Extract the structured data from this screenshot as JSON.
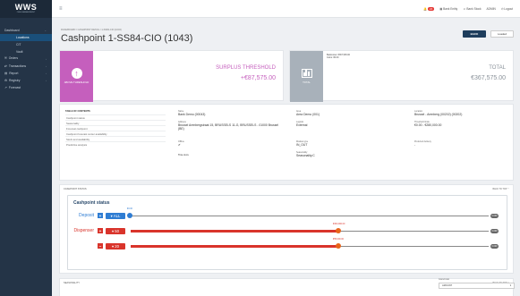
{
  "app": {
    "logo": "WWS",
    "logo_sub": "CASH MANAGEMENT"
  },
  "sidebar": {
    "items": [
      {
        "label": "Dashboard",
        "icon": "dashboard-icon"
      },
      {
        "label": "Locations",
        "active": true
      },
      {
        "label": "CIT"
      },
      {
        "label": "Vault"
      },
      {
        "label": "Orders",
        "icon": "orders-icon"
      },
      {
        "label": "Transactions",
        "icon": "transactions-icon"
      },
      {
        "label": "Report",
        "icon": "report-icon"
      },
      {
        "label": "Registry",
        "icon": "registry-icon"
      },
      {
        "label": "Forecast",
        "icon": "forecast-icon"
      }
    ]
  },
  "topbar": {
    "notif_count": "24",
    "user_entity": "Bank Entity",
    "user_name": "Bank Stock",
    "role": "ADMIN",
    "logout": "Logout"
  },
  "page": {
    "breadcrumb": "DASHBOARD / CASHPOINT DETAIL / 1-SS84-CIO (1043)",
    "title": "Cashpoint 1-SS84-CIO (1043)",
    "back_label": "BACK",
    "loaded_label": "Loaded"
  },
  "kpi_threshold": {
    "tile_label": "ABOVE THRESHOLD",
    "heading": "SURPLUS THRESHOLD",
    "value": "+€87,575.00"
  },
  "kpi_total": {
    "tile_label": "TOTAL",
    "note1": "Banknotes: €367,545.00",
    "note2": "Coins: €0.00",
    "heading": "TOTAL",
    "value": "€367,575.00"
  },
  "info": {
    "toc_title": "TABLE OF CONTENTS",
    "toc": [
      "Cashpoint status",
      "Seasonality",
      "Forecast cashpoint",
      "Cashpoint forecast center availability",
      "Stock and availability",
      "Predictive analysis"
    ],
    "fields": {
      "name_k": "Name",
      "name_v": "Bank Demo (00043)",
      "address_k": "Address",
      "address_v": "Brussel Arenbergstraat 15, BRUSSELS 11-G, BRUSSELS - 01000 Brussel (BE)",
      "offline_k": "Offline",
      "offline_v": "✔",
      "timeslots_k": "Time slots",
      "area_k": "Area",
      "area_v": "Area Demo (001)",
      "logistic_k": "Logistic",
      "logistic_v": "External",
      "model_k": "Module type",
      "model_v": "IN_OUT",
      "season_k": "Seasonality",
      "season_v": "Seasonality.C",
      "location_k": "Location",
      "location_v": "Brussel - Arenberg (00202) (00202)",
      "threshold_k": "Threshold limits",
      "threshold_v": "€0.00 - €280,000.00",
      "delivery_k": "Preferred delivery",
      "delivery_v": "-"
    }
  },
  "status_section": {
    "header": "CASHPOINT STATUS",
    "back_to_top": "BACK TO TOP",
    "panel_title": "Cashpoint status",
    "deposit_label": "Deposit",
    "dispenser_label": "Dispenser",
    "deposit_all": "ALL",
    "deposit_tip": "€0.00",
    "deposit_badge": "0.000",
    "disp1_denom": "50",
    "disp1_tip": "€300,000.00",
    "disp1_badge": "0.000",
    "disp1_fill": 0.58,
    "disp2_denom": "20",
    "disp2_tip": "€55,000.00",
    "disp2_badge": "0.000",
    "disp2_fill": 0.58,
    "colors": {
      "deposit": "#2f7dd3",
      "dispenser": "#d9342b"
    }
  },
  "seasonality_section": {
    "header": "SEASONALITY",
    "back_to_top": "BACK TO TOP",
    "select_label": "Grand total",
    "select_value": "AMOUNT"
  }
}
